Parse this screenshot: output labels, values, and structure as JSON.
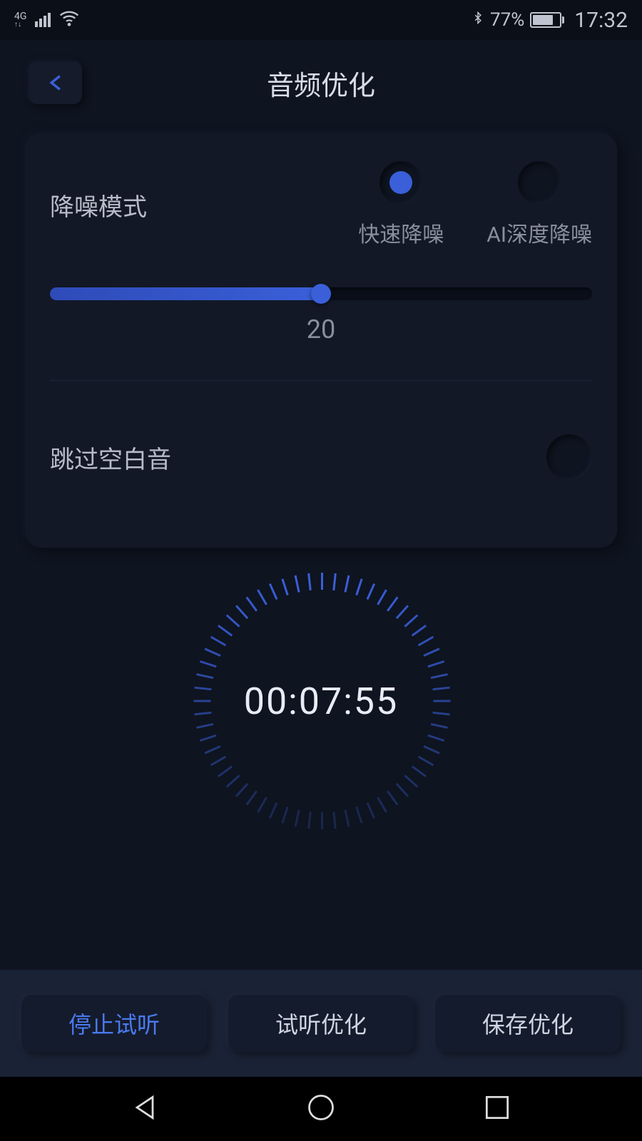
{
  "statusBar": {
    "network": "4G",
    "battery": "77%",
    "time": "17:32"
  },
  "header": {
    "title": "音频优化"
  },
  "settings": {
    "noiseMode": {
      "label": "降噪模式",
      "options": [
        {
          "label": "快速降噪",
          "selected": true
        },
        {
          "label": "AI深度降噪",
          "selected": false
        }
      ]
    },
    "slider": {
      "value": "20",
      "percent": 50
    },
    "skipBlank": {
      "label": "跳过空白音",
      "enabled": false
    }
  },
  "timer": {
    "value": "00:07:55"
  },
  "buttons": {
    "stopPreview": "停止试听",
    "previewOptimize": "试听优化",
    "saveOptimize": "保存优化"
  }
}
